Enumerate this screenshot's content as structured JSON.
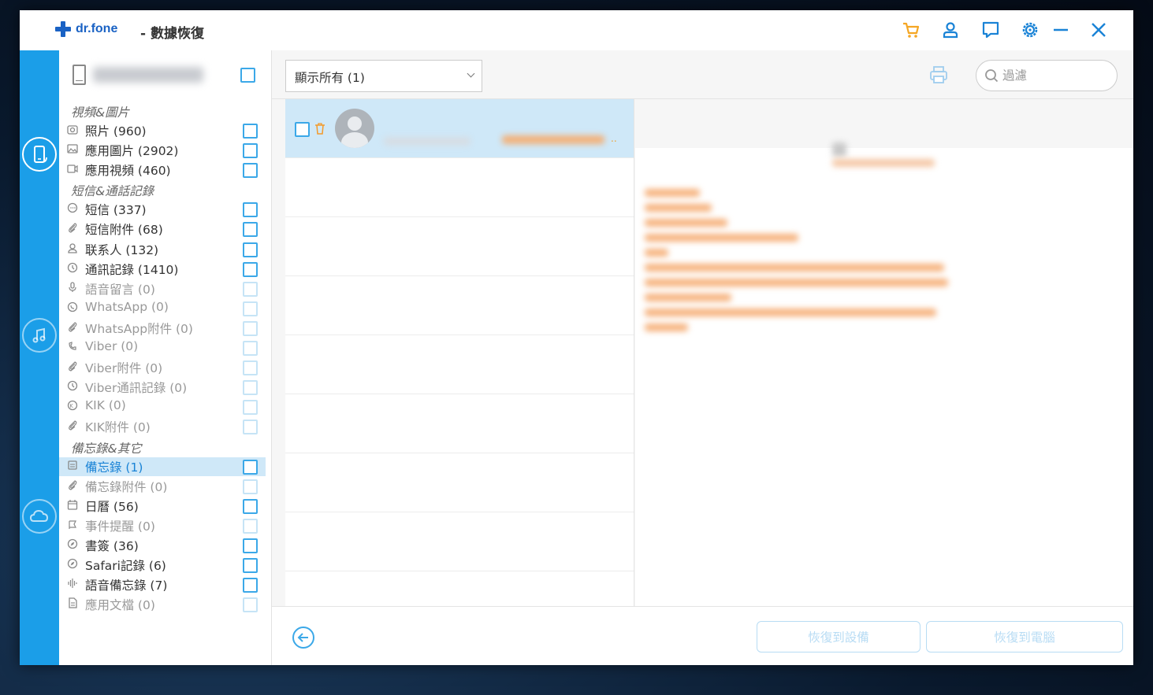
{
  "app": {
    "logo_text": "dr.fone",
    "title": "- 數據恢復"
  },
  "titlebar_icons": [
    "cart-icon",
    "user-icon",
    "feedback-icon",
    "settings-icon",
    "minimize-icon",
    "close-icon"
  ],
  "rail": {
    "items": [
      {
        "name": "device-recovery-icon",
        "active": true
      },
      {
        "name": "itunes-recovery-icon",
        "active": false
      },
      {
        "name": "icloud-recovery-icon",
        "active": false
      }
    ]
  },
  "categories": {
    "sections": [
      {
        "header": "視頻&圖片",
        "items": [
          {
            "label": "照片 (960)",
            "icon": "camera-icon",
            "enabled": true
          },
          {
            "label": "應用圖片 (2902)",
            "icon": "image-icon",
            "enabled": true
          },
          {
            "label": "應用視頻 (460)",
            "icon": "video-icon",
            "enabled": true
          }
        ]
      },
      {
        "header": "短信&通話記錄",
        "items": [
          {
            "label": "短信 (337)",
            "icon": "message-icon",
            "enabled": true
          },
          {
            "label": "短信附件 (68)",
            "icon": "attachment-icon",
            "enabled": true
          },
          {
            "label": "联系人 (132)",
            "icon": "contact-icon",
            "enabled": true
          },
          {
            "label": "通訊記錄 (1410)",
            "icon": "clock-icon",
            "enabled": true
          },
          {
            "label": "語音留言 (0)",
            "icon": "mic-icon",
            "enabled": false
          },
          {
            "label": "WhatsApp (0)",
            "icon": "whatsapp-icon",
            "enabled": false
          },
          {
            "label": "WhatsApp附件 (0)",
            "icon": "attachment-icon",
            "enabled": false
          },
          {
            "label": "Viber (0)",
            "icon": "viber-icon",
            "enabled": false
          },
          {
            "label": "Viber附件 (0)",
            "icon": "attachment-icon",
            "enabled": false
          },
          {
            "label": "Viber通訊記錄 (0)",
            "icon": "clock-icon",
            "enabled": false
          },
          {
            "label": "KIK (0)",
            "icon": "kik-icon",
            "enabled": false
          },
          {
            "label": "KIK附件 (0)",
            "icon": "attachment-icon",
            "enabled": false
          }
        ]
      },
      {
        "header": "備忘錄&其它",
        "items": [
          {
            "label": "備忘錄 (1)",
            "icon": "notes-icon",
            "enabled": true,
            "selected": true
          },
          {
            "label": "備忘錄附件 (0)",
            "icon": "attachment-icon",
            "enabled": false
          },
          {
            "label": "日曆 (56)",
            "icon": "calendar-icon",
            "enabled": true
          },
          {
            "label": "事件提醒 (0)",
            "icon": "reminder-icon",
            "enabled": false
          },
          {
            "label": "書簽 (36)",
            "icon": "compass-icon",
            "enabled": true
          },
          {
            "label": "Safari記錄 (6)",
            "icon": "compass-icon",
            "enabled": true
          },
          {
            "label": "語音備忘錄 (7)",
            "icon": "waveform-icon",
            "enabled": true
          },
          {
            "label": "應用文檔 (0)",
            "icon": "document-icon",
            "enabled": false
          }
        ]
      }
    ]
  },
  "toolbar": {
    "filter_value": "顯示所有 (1)",
    "search_placeholder": "過濾"
  },
  "list": {
    "total_rows": 8,
    "selected_row": 0
  },
  "buttons": {
    "recover_to_device": "恢復到設備",
    "recover_to_computer": "恢復到電腦"
  },
  "colors": {
    "accent": "#1b9ee8",
    "checkbox": "#3ba8e8",
    "selected_bg": "#cfe8f8",
    "cart": "#f5a623",
    "title_icons": "#1a83d6"
  }
}
